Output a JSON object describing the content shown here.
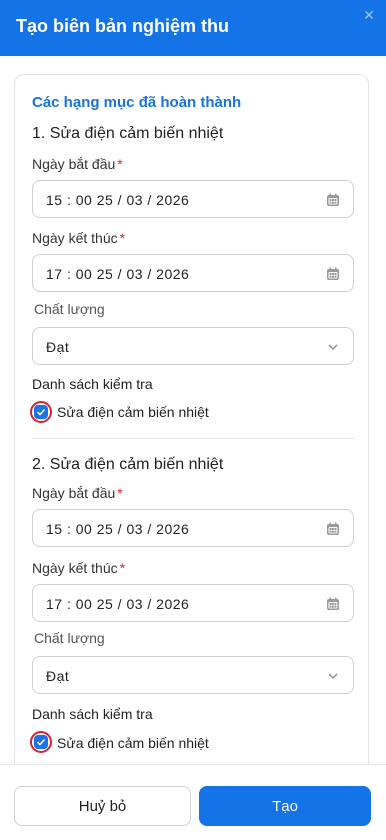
{
  "header": {
    "title": "Tạo biên bản nghiệm thu",
    "close_icon": "close-icon"
  },
  "section": {
    "title": "Các hạng mục đã hoàn thành"
  },
  "items": [
    {
      "title": "1.  Sửa điện cảm biến nhiệt",
      "start_label": "Ngày bắt đầu",
      "start_value": "15 : 00  25 / 03 / 2026",
      "end_label": "Ngày kết thúc",
      "end_value": "17 : 00  25 / 03 / 2026",
      "quality_label": "Chất lượng",
      "quality_value": "Đạt",
      "checklist_label": "Danh sách kiểm tra",
      "checklist_item": "Sửa điện cảm biến nhiệt",
      "checked": true
    },
    {
      "title": "2.  Sửa điện cảm biến nhiệt",
      "start_label": "Ngày bắt đầu",
      "start_value": "15 : 00  25 / 03 / 2026",
      "end_label": "Ngày kết thúc",
      "end_value": "17 : 00  25 / 03 / 2026",
      "quality_label": "Chất lượng",
      "quality_value": "Đạt",
      "checklist_label": "Danh sách kiểm tra",
      "checklist_item": "Sửa điện cảm biến nhiệt",
      "checked": true
    }
  ],
  "required_mark": "*",
  "footer": {
    "cancel_label": "Huỷ bỏ",
    "create_label": "Tạo"
  },
  "colors": {
    "primary": "#1473e6",
    "required": "#e02424",
    "highlight_ring": "#d8232a"
  }
}
